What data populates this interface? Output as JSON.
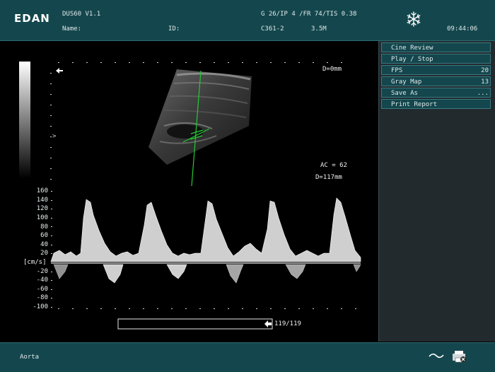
{
  "header": {
    "brand": "EDAN",
    "model": "DUS60 V1.1",
    "name_label": "Name:",
    "id_label": "ID:",
    "params": "G 26/IP 4 /FR 74/TIS 0.38",
    "probe": "C361-2",
    "frequency": "3.5M",
    "time": "09:44:06",
    "freeze_icon": "snowflake-icon"
  },
  "image": {
    "depth_top": "D=0mm",
    "angle_correction": "AC = 62",
    "gate_depth": "D=117mm"
  },
  "spectral": {
    "unit": "[cm/s]",
    "ticks": [
      "160",
      "140",
      "120",
      "100",
      "80",
      "60",
      "40",
      "20",
      "-20",
      "-40",
      "-60",
      "-80",
      "-100"
    ]
  },
  "cine": {
    "frame_counter": "119/119",
    "progress": 1.0
  },
  "menu": {
    "items": [
      {
        "label": "Cine Review",
        "value": ""
      },
      {
        "label": "Play / Stop",
        "value": ""
      },
      {
        "label": "FPS",
        "value": "20"
      },
      {
        "label": "Gray Map",
        "value": "13"
      },
      {
        "label": "Save As",
        "value": "..."
      },
      {
        "label": "Print Report",
        "value": ""
      }
    ]
  },
  "footer": {
    "exam": "Aorta",
    "wave_icon": "tilde-wave-icon",
    "printer_icon": "printer-icon"
  },
  "colors": {
    "bar_bg": "#14474d",
    "panel_bg": "#232a2e",
    "caliper": "#22cc33"
  }
}
